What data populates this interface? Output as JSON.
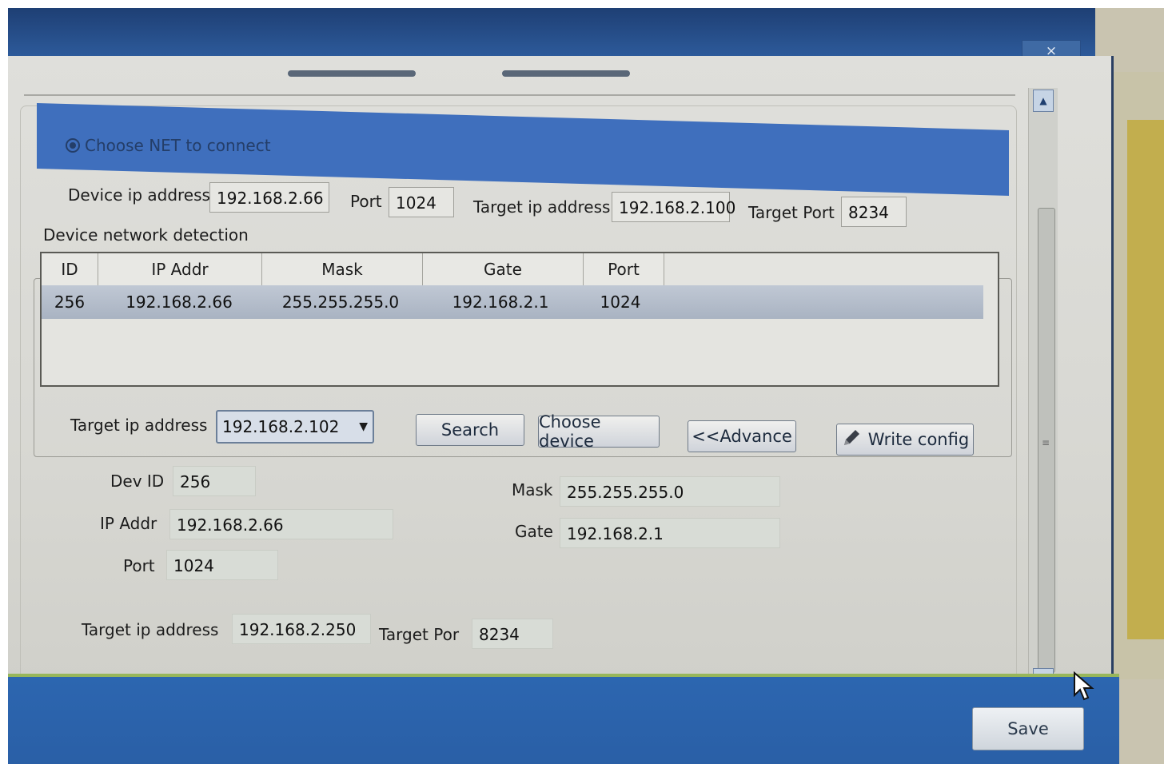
{
  "window": {
    "close_label": "×"
  },
  "net_section": {
    "radio_label": "Choose NET to connect",
    "device_ip_label": "Device ip address",
    "device_ip_value": "192.168.2.66",
    "port_label": "Port",
    "port_value": "1024",
    "target_ip_label": "Target ip address",
    "target_ip_value": "192.168.2.100",
    "target_port_label": "Target Port",
    "target_port_value": "8234"
  },
  "detection": {
    "title": "Device network detection",
    "columns": [
      "ID",
      "IP Addr",
      "Mask",
      "Gate",
      "Port"
    ],
    "rows": [
      [
        "256",
        "192.168.2.66",
        "255.255.255.0",
        "192.168.2.1",
        "1024"
      ]
    ]
  },
  "search_bar": {
    "target_ip_label": "Target ip address",
    "target_ip_selected": "192.168.2.102",
    "search_label": "Search",
    "choose_device_label": "Choose device",
    "advance_label": "<<Advance",
    "write_config_label": "Write config"
  },
  "device_form": {
    "dev_id_label": "Dev ID",
    "dev_id_value": "256",
    "ip_addr_label": "IP Addr",
    "ip_addr_value": "192.168.2.66",
    "port_label": "Port",
    "port_value": "1024",
    "mask_label": "Mask",
    "mask_value": "255.255.255.0",
    "gate_label": "Gate",
    "gate_value": "192.168.2.1",
    "target_ip_label": "Target ip address",
    "target_ip_value": "192.168.2.250",
    "target_port_label": "Target Por",
    "target_port_value": "8234"
  },
  "footer": {
    "save_label": "Save"
  },
  "icons": {
    "dropdown": "chevron-down-icon",
    "write": "pencil-icon",
    "scroll_up": "scroll-up-arrow-icon",
    "scroll_down": "scroll-down-arrow-icon",
    "cursor": "mouse-pointer-icon"
  },
  "colors": {
    "title_bar": "#1e3f74",
    "section_header": "#3f6fbd",
    "footer_bar": "#2c66b0",
    "selected_row": "#b4bccb"
  }
}
